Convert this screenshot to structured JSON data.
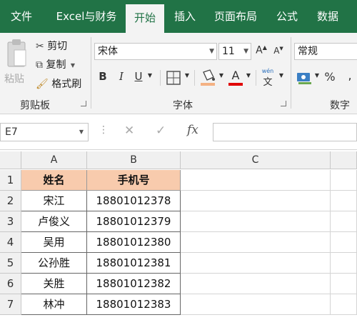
{
  "tabs": [
    {
      "label": "文件",
      "active": false
    },
    {
      "label": "Excel与财务",
      "active": false
    },
    {
      "label": "开始",
      "active": true
    },
    {
      "label": "插入",
      "active": false
    },
    {
      "label": "页面布局",
      "active": false
    },
    {
      "label": "公式",
      "active": false
    },
    {
      "label": "数据",
      "active": false
    }
  ],
  "clipboard": {
    "paste": "粘贴",
    "cut": "剪切",
    "copy": "复制",
    "format_painter": "格式刷",
    "group_label": "剪贴板"
  },
  "font": {
    "font_name": "宋体",
    "font_size": "11",
    "bold": "B",
    "italic": "I",
    "underline": "U",
    "font_color_letter": "A",
    "group_label": "字体",
    "phonetic": "文"
  },
  "number": {
    "format": "常规",
    "percent": "%",
    "group_label": "数字"
  },
  "formula_bar": {
    "name_box": "E7",
    "fx": "fx",
    "content": ""
  },
  "sheet": {
    "columns": [
      "A",
      "B",
      "C"
    ],
    "rows": [
      "1",
      "2",
      "3",
      "4",
      "5",
      "6",
      "7"
    ],
    "header": [
      "姓名",
      "手机号"
    ],
    "data": [
      [
        "宋江",
        "18801012378"
      ],
      [
        "卢俊义",
        "18801012379"
      ],
      [
        "吴用",
        "18801012380"
      ],
      [
        "公孙胜",
        "18801012381"
      ],
      [
        "关胜",
        "18801012382"
      ],
      [
        "林冲",
        "18801012383"
      ]
    ]
  },
  "colors": {
    "accent": "#217346",
    "header_fill": "#f8cbad",
    "font_color_bar": "#e00000",
    "fill_color_bar": "#f4b183"
  }
}
